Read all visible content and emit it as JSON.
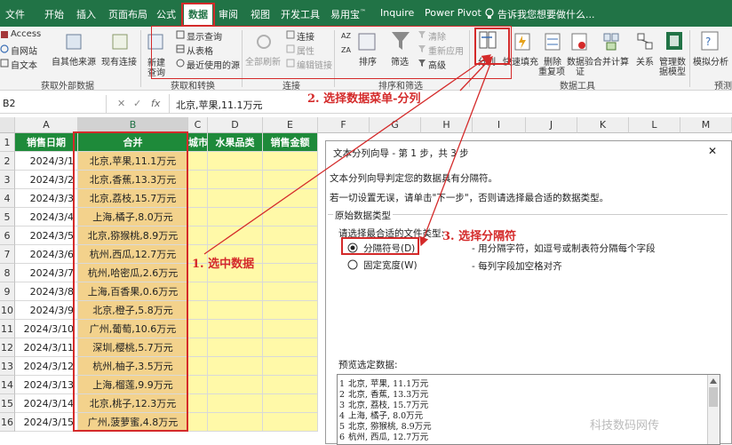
{
  "menubar": {
    "tabs": [
      "文件",
      "开始",
      "插入",
      "页面布局",
      "公式",
      "数据",
      "审阅",
      "视图",
      "开发工具",
      "易用宝",
      "Inquire",
      "Power Pivot"
    ],
    "tab_suffix": "™",
    "active_tab": "数据",
    "tell_me": "告诉我您想要做什么..."
  },
  "ribbon": {
    "get_external": {
      "access": "Access",
      "web": "自网站",
      "text": "自文本",
      "other": "自其他来源",
      "existing": "现有连接",
      "group_label": "获取外部数据"
    },
    "get_transform": {
      "new_query_1": "新建",
      "new_query_2": "查询",
      "show_queries": "显示查询",
      "from_table": "从表格",
      "recent_sources": "最近使用的源",
      "group_label": "获取和转换"
    },
    "connections": {
      "refresh_all": "全部刷新",
      "connections": "连接",
      "properties": "属性",
      "edit_links": "编辑链接",
      "group_label": "连接"
    },
    "sort_filter": {
      "sort": "排序",
      "filter": "筛选",
      "clear": "清除",
      "reapply": "重新应用",
      "advanced": "高级",
      "group_label": "排序和筛选"
    },
    "data_tools": {
      "text_to_columns": "分列",
      "flash_fill": "快速填充",
      "remove_dup_1": "删除",
      "remove_dup_2": "重复项",
      "validation_1": "数据验",
      "validation_2": "证",
      "consolidate": "合并计算",
      "relationships": "关系",
      "manage_model_1": "管理数",
      "manage_model_2": "据模型",
      "group_label": "数据工具"
    },
    "forecast": {
      "what_if_1": "模拟分析",
      "group_label": "预测"
    }
  },
  "formula_bar": {
    "name_box": "B2",
    "fx": "fx",
    "value": "北京,苹果,11.1万元"
  },
  "sheet": {
    "columns": [
      "A",
      "B",
      "C",
      "D",
      "E",
      "F",
      "G",
      "H",
      "I",
      "J",
      "K",
      "L",
      "M"
    ],
    "row_numbers": [
      "1",
      "2",
      "3",
      "4",
      "5",
      "6",
      "7",
      "8",
      "9",
      "10",
      "11",
      "12",
      "13",
      "14",
      "15",
      "16"
    ],
    "headers": [
      "销售日期",
      "合并",
      "城市",
      "水果品类",
      "销售金额"
    ],
    "dates": [
      "2024/3/1",
      "2024/3/2",
      "2024/3/3",
      "2024/3/4",
      "2024/3/5",
      "2024/3/6",
      "2024/3/7",
      "2024/3/8",
      "2024/3/9",
      "2024/3/10",
      "2024/3/11",
      "2024/3/12",
      "2024/3/13",
      "2024/3/14",
      "2024/3/15"
    ],
    "merged": [
      "北京,苹果,11.1万元",
      "北京,香蕉,13.3万元",
      "北京,荔枝,15.7万元",
      "上海,橘子,8.0万元",
      "北京,猕猴桃,8.9万元",
      "杭州,西瓜,12.7万元",
      "杭州,哈密瓜,2.6万元",
      "上海,百香果,0.6万元",
      "北京,橙子,5.8万元",
      "广州,葡萄,10.6万元",
      "深圳,樱桃,5.7万元",
      "杭州,柚子,3.5万元",
      "上海,榴莲,9.9万元",
      "北京,桃子,12.3万元",
      "广州,菠萝蜜,4.8万元"
    ]
  },
  "dialog": {
    "title": "文本分列向导 - 第 1 步，共 3 步",
    "close": "✕",
    "line1": "文本分列向导判定您的数据具有分隔符。",
    "line2": "若一切设置无误，请单击\"下一步\"，否则请选择最合适的数据类型。",
    "section": "原始数据类型",
    "choose_label": "请选择最合适的文件类型:",
    "opt1": "分隔符号(D)",
    "opt1_desc": "- 用分隔字符，如逗号或制表符分隔每个字段",
    "opt2": "固定宽度(W)",
    "opt2_desc": "- 每列字段加空格对齐",
    "preview_label": "预览选定数据:",
    "preview_rows": [
      {
        "n": "1",
        "t": "北京, 苹果, 11.1万元"
      },
      {
        "n": "2",
        "t": "北京, 香蕉, 13.3万元"
      },
      {
        "n": "3",
        "t": "北京, 荔枝, 15.7万元"
      },
      {
        "n": "4",
        "t": "上海, 橘子, 8.0万元"
      },
      {
        "n": "5",
        "t": "北京, 猕猴桃, 8.9万元"
      },
      {
        "n": "6",
        "t": "杭州, 西瓜, 12.7万元"
      }
    ]
  },
  "annotations": {
    "step1": "1. 选中数据",
    "step2": "2. 选择数据菜单-分列",
    "step3": "3. 选择分隔符"
  },
  "watermark": "科技数码网传",
  "colors": {
    "excel_green": "#217346",
    "header_green": "#1e8a3a",
    "merged_fill": "#f3d28c",
    "yellow_fill": "#fff9a8",
    "annotation_red": "#d42a2a"
  }
}
